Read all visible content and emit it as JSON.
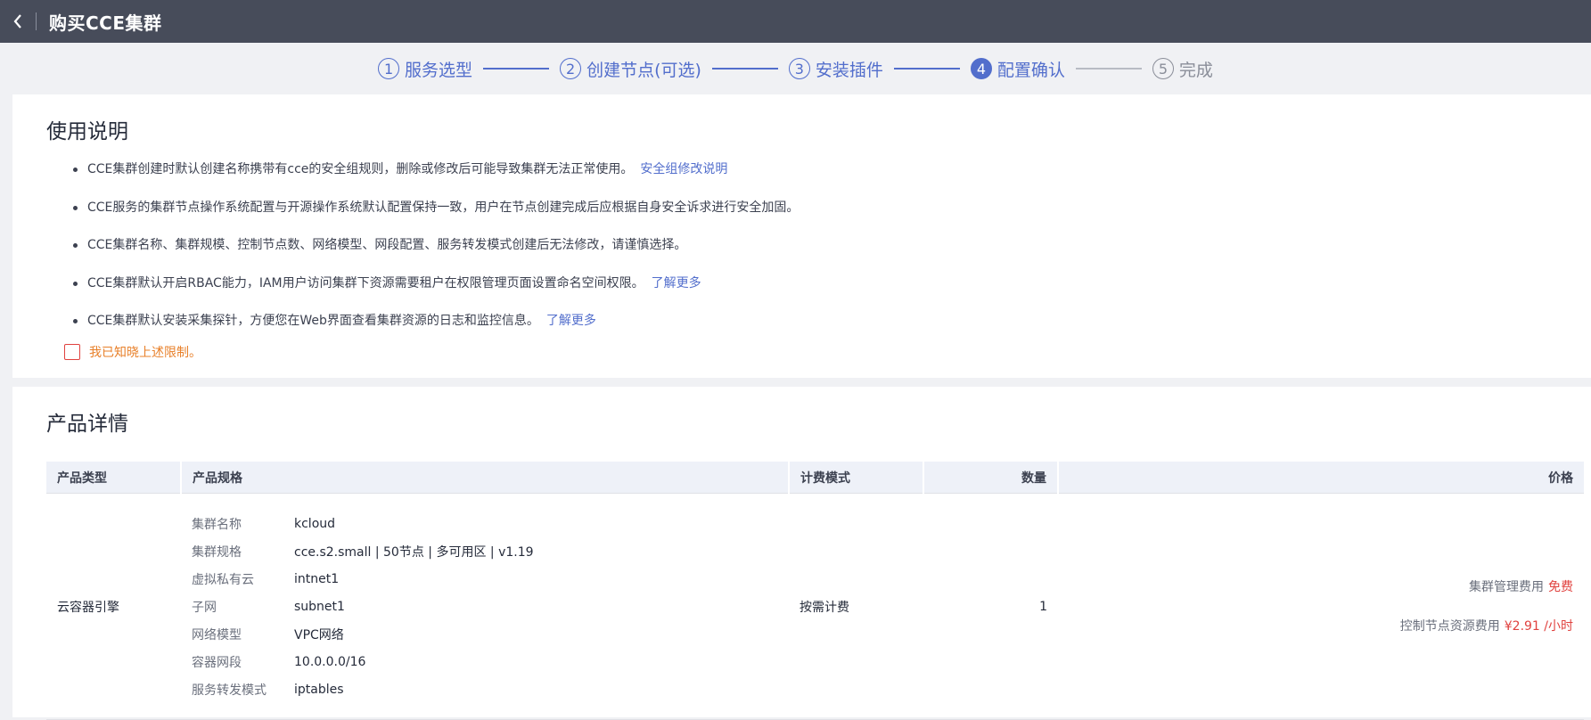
{
  "header": {
    "title": "购买CCE集群"
  },
  "steps": [
    {
      "num": "1",
      "label": "服务选型"
    },
    {
      "num": "2",
      "label": "创建节点(可选)"
    },
    {
      "num": "3",
      "label": "安装插件"
    },
    {
      "num": "4",
      "label": "配置确认"
    },
    {
      "num": "5",
      "label": "完成"
    }
  ],
  "notice": {
    "title": "使用说明",
    "items": [
      {
        "text": "CCE集群创建时默认创建名称携带有cce的安全组规则，删除或修改后可能导致集群无法正常使用。",
        "link": "安全组修改说明"
      },
      {
        "text": "CCE服务的集群节点操作系统配置与开源操作系统默认配置保持一致，用户在节点创建完成后应根据自身安全诉求进行安全加固。"
      },
      {
        "text": "CCE集群名称、集群规模、控制节点数、网络模型、网段配置、服务转发模式创建后无法修改，请谨慎选择。"
      },
      {
        "text": "CCE集群默认开启RBAC能力，IAM用户访问集群下资源需要租户在权限管理页面设置命名空间权限。",
        "link": "了解更多"
      },
      {
        "text": "CCE集群默认安装采集探针，方便您在Web界面查看集群资源的日志和监控信息。",
        "link": "了解更多"
      }
    ],
    "ack": "我已知晓上述限制。"
  },
  "product": {
    "title": "产品详情",
    "columns": [
      "产品类型",
      "产品规格",
      "计费模式",
      "数量",
      "价格"
    ],
    "row": {
      "type": "云容器引擎",
      "specs": [
        {
          "k": "集群名称",
          "v": "kcloud"
        },
        {
          "k": "集群规格",
          "v": "cce.s2.small | 50节点 | 多可用区 | v1.19"
        },
        {
          "k": "虚拟私有云",
          "v": "intnet1"
        },
        {
          "k": "子网",
          "v": "subnet1"
        },
        {
          "k": "网络模型",
          "v": "VPC网络"
        },
        {
          "k": "容器网段",
          "v": "10.0.0.0/16"
        },
        {
          "k": "服务转发模式",
          "v": "iptables"
        }
      ],
      "billing": "按需计费",
      "quantity": "1",
      "fees": [
        {
          "label": "集群管理费用",
          "value": "免费"
        },
        {
          "label": "控制节点资源费用",
          "value": "¥2.91 /小时"
        }
      ]
    }
  },
  "colors": {
    "accent": "#526ecc",
    "danger": "#e0423f",
    "warning": "#e8802a",
    "topbar": "#474c5a"
  }
}
